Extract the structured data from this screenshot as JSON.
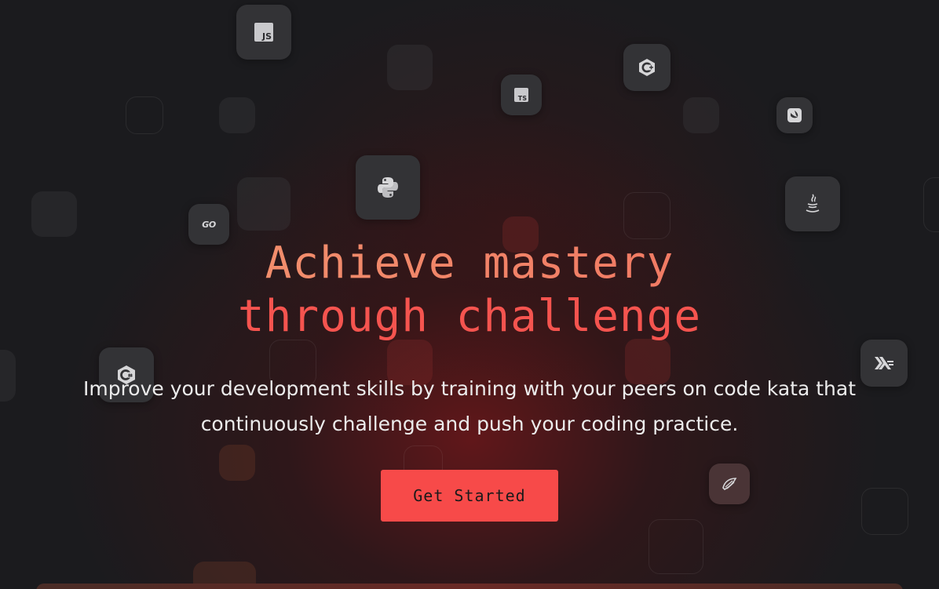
{
  "hero": {
    "headline_line1": "Achieve mastery",
    "headline_line2": "through challenge",
    "subtitle_line1": "Improve your development skills by training with your peers on code kata that",
    "subtitle_line2": "continuously challenge and push your coding practice.",
    "cta_label": "Get Started"
  },
  "icons": {
    "js": {
      "name": "javascript-icon",
      "text": "JS"
    },
    "ts": {
      "name": "typescript-icon",
      "text": "TS"
    },
    "cpp": "cplusplus-icon",
    "swift": "swift-icon",
    "python": "python-icon",
    "go": {
      "name": "go-icon",
      "text": "GO"
    },
    "java": "java-icon",
    "csharp": "csharp-icon",
    "haskell": "haskell-icon",
    "elixir": "elixir-icon"
  },
  "colors": {
    "background": "#1b1b1e",
    "accent": "#f74a49",
    "headline_gradient_start": "#f29a72",
    "headline_line2": "#f5544f",
    "tile": "#333336",
    "subtitle_text": "#ececec"
  }
}
